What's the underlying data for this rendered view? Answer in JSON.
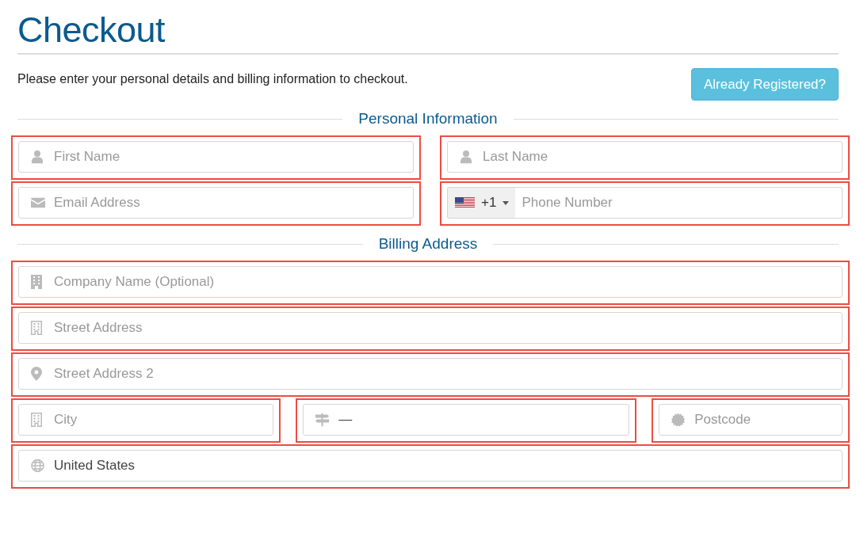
{
  "title": "Checkout",
  "intro": "Please enter your personal details and billing information to checkout.",
  "login_button": "Already Registered?",
  "sections": [
    {
      "heading": "Personal Information",
      "rows": [
        [
          {
            "kind": "person",
            "placeholder": "First Name"
          },
          {
            "kind": "person",
            "placeholder": "Last Name"
          }
        ],
        [
          {
            "kind": "email",
            "placeholder": "Email Address"
          },
          {
            "kind": "phone",
            "dial_code": "+1",
            "placeholder": "Phone Number"
          }
        ]
      ]
    },
    {
      "heading": "Billing Address",
      "rows": [
        [
          {
            "kind": "company",
            "placeholder": "Company Name (Optional)"
          }
        ],
        [
          {
            "kind": "street",
            "placeholder": "Street Address"
          }
        ],
        [
          {
            "kind": "location",
            "placeholder": "Street Address 2"
          }
        ],
        [
          {
            "kind": "street",
            "placeholder": "City"
          },
          {
            "kind": "state",
            "value": "—"
          },
          {
            "kind": "postcode",
            "placeholder": "Postcode"
          }
        ],
        [
          {
            "kind": "country",
            "value": "United States"
          }
        ]
      ]
    }
  ]
}
